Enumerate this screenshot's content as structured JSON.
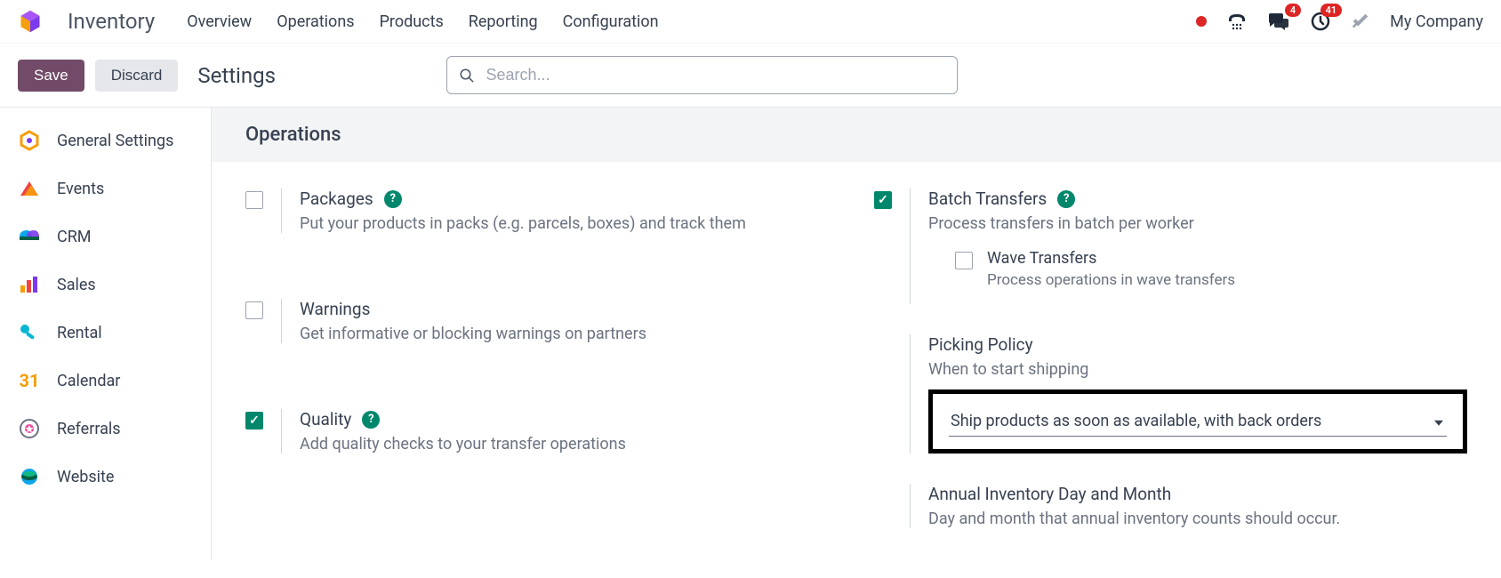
{
  "header": {
    "app_title": "Inventory",
    "nav": [
      "Overview",
      "Operations",
      "Products",
      "Reporting",
      "Configuration"
    ],
    "badges": {
      "messages": "4",
      "activities": "41"
    },
    "company": "My Company"
  },
  "actionbar": {
    "save": "Save",
    "discard": "Discard",
    "title": "Settings",
    "search_placeholder": "Search..."
  },
  "sidebar": {
    "items": [
      {
        "label": "General Settings"
      },
      {
        "label": "Events"
      },
      {
        "label": "CRM"
      },
      {
        "label": "Sales"
      },
      {
        "label": "Rental"
      },
      {
        "label": "Calendar"
      },
      {
        "label": "Referrals"
      },
      {
        "label": "Website"
      }
    ]
  },
  "main": {
    "section": "Operations",
    "left": {
      "packages": {
        "title": "Packages",
        "desc": "Put your products in packs (e.g. parcels, boxes) and track them",
        "checked": false
      },
      "warnings": {
        "title": "Warnings",
        "desc": "Get informative or blocking warnings on partners",
        "checked": false
      },
      "quality": {
        "title": "Quality",
        "desc": "Add quality checks to your transfer operations",
        "checked": true
      }
    },
    "right": {
      "batch": {
        "title": "Batch Transfers",
        "desc": "Process transfers in batch per worker",
        "checked": true,
        "sub": {
          "title": "Wave Transfers",
          "desc": "Process operations in wave transfers",
          "checked": false
        }
      },
      "picking": {
        "title": "Picking Policy",
        "desc": "When to start shipping",
        "value": "Ship products as soon as available, with back orders"
      },
      "annual": {
        "title": "Annual Inventory Day and Month",
        "desc": "Day and month that annual inventory counts should occur."
      }
    }
  }
}
